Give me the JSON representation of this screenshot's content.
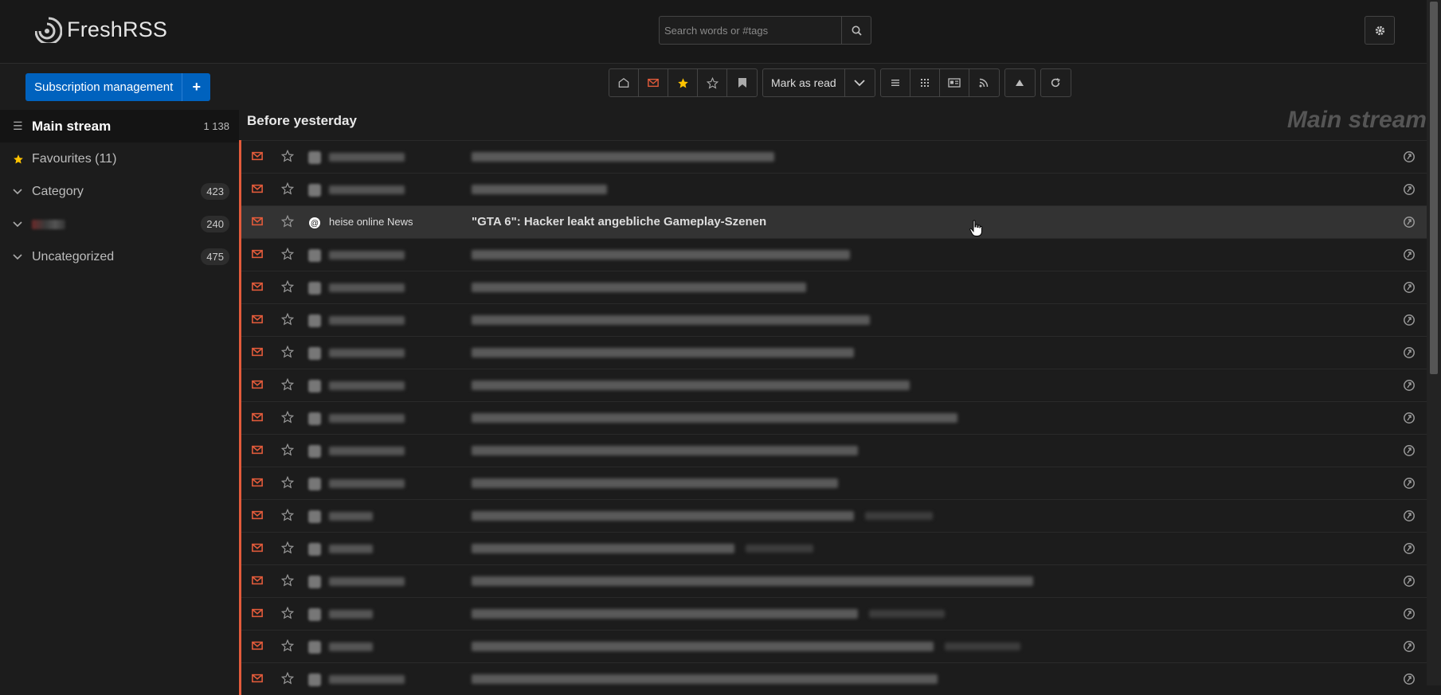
{
  "app": {
    "name": "FreshRSS"
  },
  "header": {
    "search_placeholder": "Search words or #tags",
    "search_icon": "search-icon",
    "settings_icon": "gear-icon"
  },
  "sidebar": {
    "subscription_button": "Subscription management",
    "add_button": "+",
    "items": [
      {
        "label": "Main stream",
        "count": "1 138",
        "icon": "list-icon",
        "active": true
      },
      {
        "label": "Favourites (11)",
        "count": "",
        "icon": "star-icon"
      },
      {
        "label": "Category",
        "count": "423",
        "icon": "chevron-down-icon"
      },
      {
        "label": "",
        "count": "240",
        "icon": "chevron-down-icon",
        "blurred": true
      },
      {
        "label": "Uncategorized",
        "count": "475",
        "icon": "chevron-down-icon"
      }
    ]
  },
  "toolbar": {
    "mark_as_read": "Mark as read",
    "buttons": [
      "read-icon",
      "unread-icon",
      "favourite-icon",
      "not-favourite-icon",
      "bookmark-icon",
      "normal-view-icon",
      "global-view-icon",
      "reader-view-icon",
      "rss-icon",
      "sort-icon",
      "refresh-icon"
    ]
  },
  "main": {
    "day_header": "Before yesterday",
    "stream_name": "Main stream",
    "focused_entry": {
      "feed": "heise online News",
      "title": "\"GTA 6\": Hacker leakt angebliche Gameplay-Szenen"
    }
  },
  "colors": {
    "accent_orange": "#e35b3b",
    "primary_blue": "#0062be",
    "favourite_yellow": "#ffc300"
  }
}
